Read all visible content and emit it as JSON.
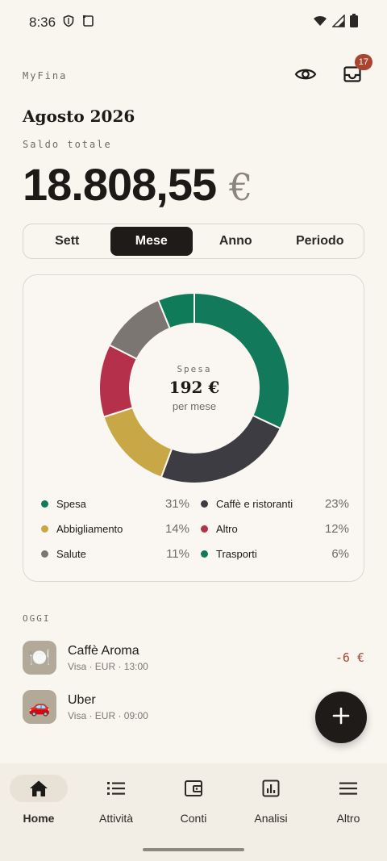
{
  "status_bar": {
    "time": "8:36",
    "icons": [
      "shield-icon",
      "sim-card-icon",
      "wifi-icon",
      "signal-icon",
      "battery-icon"
    ]
  },
  "header": {
    "brand": "MyFina",
    "visibility_icon": "eye-icon",
    "inbox_icon": "inbox-icon",
    "inbox_badge": "17"
  },
  "summary": {
    "period_title": "Agosto 2026",
    "balance_label": "Saldo totale",
    "balance_amount": "18.808,55",
    "currency": "€"
  },
  "tabs": [
    {
      "label": "Sett",
      "active": false
    },
    {
      "label": "Mese",
      "active": true
    },
    {
      "label": "Anno",
      "active": false
    },
    {
      "label": "Periodo",
      "active": false
    }
  ],
  "chart_data": {
    "type": "pie",
    "center": {
      "title": "Spesa",
      "value": "192 €",
      "subtitle": "per mese"
    },
    "categories": [
      "Spesa",
      "Caffè e ristoranti",
      "Abbigliamento",
      "Altro",
      "Salute",
      "Trasporti"
    ],
    "values": [
      31,
      23,
      14,
      12,
      11,
      6
    ],
    "labels": [
      "31%",
      "23%",
      "14%",
      "12%",
      "11%",
      "6%"
    ],
    "colors": [
      "#127a5b",
      "#3d3c42",
      "#c7a746",
      "#b5304a",
      "#7b7671",
      "#0f7b59"
    ],
    "legend_order": [
      0,
      1,
      2,
      3,
      4,
      5
    ]
  },
  "transactions_section": "OGGI",
  "transactions": [
    {
      "name": "Caffè Aroma",
      "meta": "Visa · EUR · 13:00",
      "amount": "-6 €",
      "icon": "🍽️"
    },
    {
      "name": "Uber",
      "meta": "Visa · EUR · 09:00",
      "amount": "",
      "icon": "🚗"
    }
  ],
  "fab": {
    "label": "+"
  },
  "nav": [
    {
      "label": "Home",
      "icon": "home-icon",
      "active": true
    },
    {
      "label": "Attività",
      "icon": "list-icon",
      "active": false
    },
    {
      "label": "Conti",
      "icon": "wallet-icon",
      "active": false
    },
    {
      "label": "Analisi",
      "icon": "chart-icon",
      "active": false
    },
    {
      "label": "Altro",
      "icon": "menu-icon",
      "active": false
    }
  ]
}
